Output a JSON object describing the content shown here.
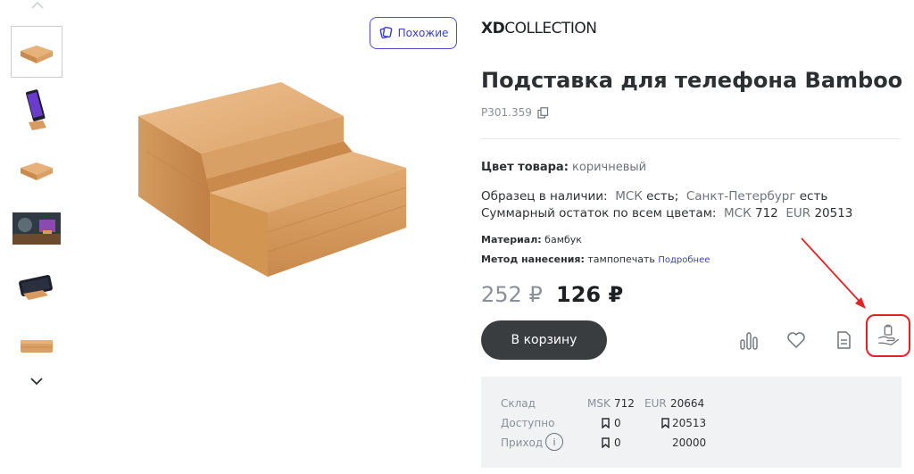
{
  "thumbnails": {
    "items": [
      {
        "name": "thumb-bamboo-stand-front",
        "active": true
      },
      {
        "name": "thumb-phone-on-stand",
        "active": false
      },
      {
        "name": "thumb-bamboo-stand-angle",
        "active": false
      },
      {
        "name": "thumb-lifestyle-desk",
        "active": false
      },
      {
        "name": "thumb-phone-landscape",
        "active": false
      },
      {
        "name": "thumb-bamboo-stand-side",
        "active": false
      }
    ]
  },
  "similar_button": {
    "label": "Похожие"
  },
  "brand": {
    "part1": "XD",
    "part2": "COLLECTION"
  },
  "product": {
    "title": "Подставка для телефона Bamboo",
    "sku": "P301.359",
    "color_label": "Цвет товара:",
    "color_value": "коричневый",
    "sample_label": "Образец в наличии:",
    "sample_msk": "МСК",
    "sample_msk_status": "есть;",
    "sample_spb": "Санкт-Петербург",
    "sample_spb_status": "есть",
    "total_label": "Суммарный остаток по всем цветам:",
    "total_msk_label": "МСК",
    "total_msk_value": "712",
    "total_eur_label": "EUR",
    "total_eur_value": "20513",
    "material_label": "Материал:",
    "material_value": "бамбук",
    "method_label": "Метод нанесения:",
    "method_value": "тампопечать",
    "method_link": "Подробнее",
    "old_price": "252 ₽",
    "new_price": "126 ₽"
  },
  "cart_button": {
    "label": "В корзину"
  },
  "actions": [
    "compare-icon",
    "heart-icon",
    "document-icon",
    "hand-bag-icon"
  ],
  "stock": {
    "row1_label": "Склад",
    "msk_label": "MSK",
    "msk_value": "712",
    "eur_label": "EUR",
    "eur_value": "20664",
    "row2_label": "Доступно",
    "avail_msk": "0",
    "avail_eur": "20513",
    "row3_label": "Приход",
    "incoming_msk": "0",
    "incoming_eur": "20000"
  },
  "colors": {
    "accent": "#3a3fbf",
    "highlight": "#e02424",
    "button": "#3a3d40"
  }
}
